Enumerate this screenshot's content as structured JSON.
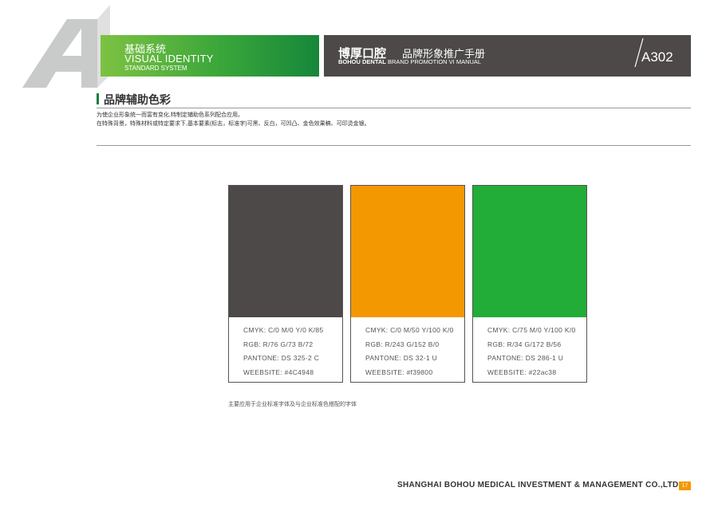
{
  "header": {
    "big_letter": "A",
    "section_cn": "基础系统",
    "section_en": "VISUAL IDENTITY",
    "section_en_sub": "STANDARD SYSTEM",
    "brand_cn": "博厚口腔",
    "manual_cn": "品牌形象推广手册",
    "brand_en": "BOHOU DENTAL",
    "manual_en": "BRAND PROMOTION VI MANUAL",
    "page_code": "A302"
  },
  "section": {
    "title": "品牌辅助色彩",
    "desc_line1": "为使企业形象统一而富有变化,特制定辅助色系列配合应用。",
    "desc_line2": "在特殊背景，特殊材料或特定要求下,基本要素(标志，标准字)可黑、反白，可凹凸、金色效果稿、可印烫金银。"
  },
  "swatches": [
    {
      "color": "#4c4948",
      "cmyk": "CMYK: C/0 M/0 Y/0 K/85",
      "rgb": "RGB: R/76 G/73 B/72",
      "pantone": "PANTONE: DS 325-2 C",
      "web": "WEEBSITE: #4C4948"
    },
    {
      "color": "#f39800",
      "cmyk": "CMYK: C/0 M/50 Y/100 K/0",
      "rgb": "RGB: R/243 G/152 B/0",
      "pantone": "PANTONE: DS 32-1 U",
      "web": "WEEBSITE: #f39800"
    },
    {
      "color": "#22ac38",
      "cmyk": "CMYK: C/75 M/0 Y/100 K/0",
      "rgb": "RGB: R/34 G/172 B/56",
      "pantone": "PANTONE: DS  286-1 U",
      "web": "WEEBSITE: #22ac38"
    }
  ],
  "caption": "主要应用于企业标准字体及与企业标准色搭配的字体",
  "footer": {
    "company": "SHANGHAI BOHOU MEDICAL INVESTMENT & MANAGEMENT CO.,LTD.",
    "page_number": "17"
  }
}
